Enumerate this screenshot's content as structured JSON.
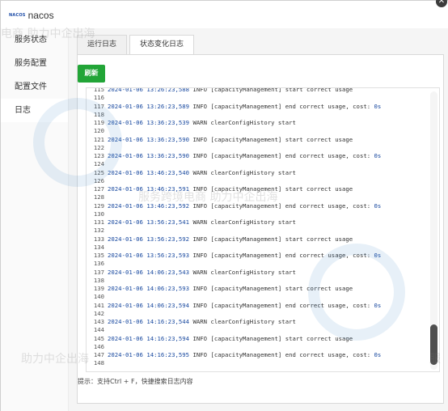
{
  "app": {
    "logo_mark": "NACOS",
    "name": "nacos",
    "close_label": "✕"
  },
  "sidebar": {
    "items": [
      {
        "label": "服务状态",
        "active": false
      },
      {
        "label": "服务配置",
        "active": false
      },
      {
        "label": "配置文件",
        "active": false
      },
      {
        "label": "日志",
        "active": true
      }
    ]
  },
  "tabs": [
    {
      "label": "运行日志",
      "active": false
    },
    {
      "label": "状态变化日志",
      "active": true
    }
  ],
  "toolbar": {
    "refresh_label": "刷新"
  },
  "log": {
    "lines": [
      {
        "n": "115",
        "ts": "2024-01-06 13:26:23,588",
        "level": "INFO",
        "msg": "[capacityManagement] start correct usage",
        "cost": ""
      },
      {
        "n": "116",
        "ts": "",
        "level": "",
        "msg": "",
        "cost": ""
      },
      {
        "n": "117",
        "ts": "2024-01-06 13:26:23,589",
        "level": "INFO",
        "msg": "[capacityManagement] end correct usage, cost: ",
        "cost": "0s"
      },
      {
        "n": "118",
        "ts": "",
        "level": "",
        "msg": "",
        "cost": ""
      },
      {
        "n": "119",
        "ts": "2024-01-06 13:36:23,539",
        "level": "WARN",
        "msg": "clearConfigHistory start",
        "cost": ""
      },
      {
        "n": "120",
        "ts": "",
        "level": "",
        "msg": "",
        "cost": ""
      },
      {
        "n": "121",
        "ts": "2024-01-06 13:36:23,590",
        "level": "INFO",
        "msg": "[capacityManagement] start correct usage",
        "cost": ""
      },
      {
        "n": "122",
        "ts": "",
        "level": "",
        "msg": "",
        "cost": ""
      },
      {
        "n": "123",
        "ts": "2024-01-06 13:36:23,590",
        "level": "INFO",
        "msg": "[capacityManagement] end correct usage, cost: ",
        "cost": "0s"
      },
      {
        "n": "124",
        "ts": "",
        "level": "",
        "msg": "",
        "cost": ""
      },
      {
        "n": "125",
        "ts": "2024-01-06 13:46:23,540",
        "level": "WARN",
        "msg": "clearConfigHistory start",
        "cost": ""
      },
      {
        "n": "126",
        "ts": "",
        "level": "",
        "msg": "",
        "cost": ""
      },
      {
        "n": "127",
        "ts": "2024-01-06 13:46:23,591",
        "level": "INFO",
        "msg": "[capacityManagement] start correct usage",
        "cost": ""
      },
      {
        "n": "128",
        "ts": "",
        "level": "",
        "msg": "",
        "cost": ""
      },
      {
        "n": "129",
        "ts": "2024-01-06 13:46:23,592",
        "level": "INFO",
        "msg": "[capacityManagement] end correct usage, cost: ",
        "cost": "0s"
      },
      {
        "n": "130",
        "ts": "",
        "level": "",
        "msg": "",
        "cost": ""
      },
      {
        "n": "131",
        "ts": "2024-01-06 13:56:23,541",
        "level": "WARN",
        "msg": "clearConfigHistory start",
        "cost": ""
      },
      {
        "n": "132",
        "ts": "",
        "level": "",
        "msg": "",
        "cost": ""
      },
      {
        "n": "133",
        "ts": "2024-01-06 13:56:23,592",
        "level": "INFO",
        "msg": "[capacityManagement] start correct usage",
        "cost": ""
      },
      {
        "n": "134",
        "ts": "",
        "level": "",
        "msg": "",
        "cost": ""
      },
      {
        "n": "135",
        "ts": "2024-01-06 13:56:23,593",
        "level": "INFO",
        "msg": "[capacityManagement] end correct usage, cost: ",
        "cost": "0s"
      },
      {
        "n": "136",
        "ts": "",
        "level": "",
        "msg": "",
        "cost": ""
      },
      {
        "n": "137",
        "ts": "2024-01-06 14:06:23,543",
        "level": "WARN",
        "msg": "clearConfigHistory start",
        "cost": ""
      },
      {
        "n": "138",
        "ts": "",
        "level": "",
        "msg": "",
        "cost": ""
      },
      {
        "n": "139",
        "ts": "2024-01-06 14:06:23,593",
        "level": "INFO",
        "msg": "[capacityManagement] start correct usage",
        "cost": ""
      },
      {
        "n": "140",
        "ts": "",
        "level": "",
        "msg": "",
        "cost": ""
      },
      {
        "n": "141",
        "ts": "2024-01-06 14:06:23,594",
        "level": "INFO",
        "msg": "[capacityManagement] end correct usage, cost: ",
        "cost": "0s"
      },
      {
        "n": "142",
        "ts": "",
        "level": "",
        "msg": "",
        "cost": ""
      },
      {
        "n": "143",
        "ts": "2024-01-06 14:16:23,544",
        "level": "WARN",
        "msg": "clearConfigHistory start",
        "cost": ""
      },
      {
        "n": "144",
        "ts": "",
        "level": "",
        "msg": "",
        "cost": ""
      },
      {
        "n": "145",
        "ts": "2024-01-06 14:16:23,594",
        "level": "INFO",
        "msg": "[capacityManagement] start correct usage",
        "cost": ""
      },
      {
        "n": "146",
        "ts": "",
        "level": "",
        "msg": "",
        "cost": ""
      },
      {
        "n": "147",
        "ts": "2024-01-06 14:16:23,595",
        "level": "INFO",
        "msg": "[capacityManagement] end correct usage, cost: ",
        "cost": "0s"
      },
      {
        "n": "148",
        "ts": "",
        "level": "",
        "msg": "",
        "cost": ""
      }
    ]
  },
  "hint": "提示：支持Ctrl + F，快捷搜索日志内容",
  "watermark": {
    "text_a": "电商 助力中企出海",
    "text_b": "服务跨境电商 助力中企出海",
    "text_c": "助力中企出海",
    "text_d": "服"
  },
  "colors": {
    "accent_green": "#22a537",
    "timestamp_blue": "#1a4aa0"
  }
}
